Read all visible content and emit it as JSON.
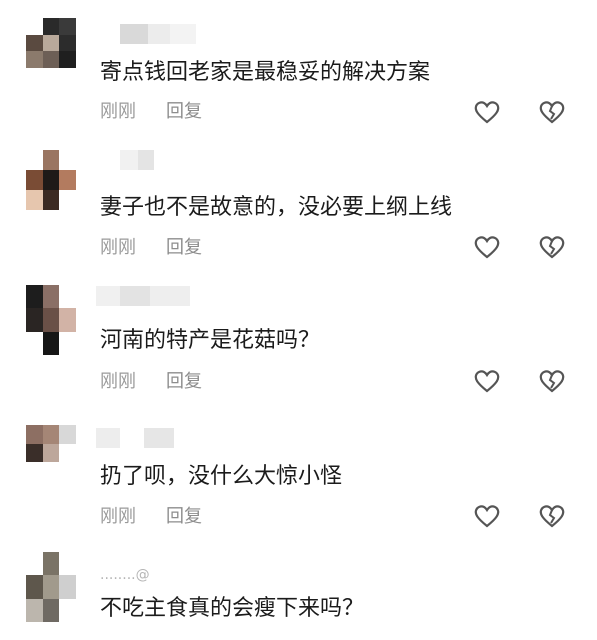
{
  "comments": [
    {
      "text": "寄点钱回老家是最稳妥的解决方案",
      "time": "刚刚",
      "reply": "回复"
    },
    {
      "text": "妻子也不是故意的，没必要上纲上线",
      "time": "刚刚",
      "reply": "回复"
    },
    {
      "text": "河南的特产是花菇吗？",
      "time": "刚刚",
      "reply": "回复"
    },
    {
      "text": "扔了呗，没什么大惊小怪",
      "time": "刚刚",
      "reply": "回复"
    },
    {
      "text": "不吃主食真的会瘦下来吗？",
      "username": "........@"
    }
  ],
  "icons": {
    "like": "heart-outline-icon",
    "dislike": "broken-heart-icon"
  },
  "colors": {
    "text": "#1b1b1b",
    "meta": "#9a9a9a",
    "icon": "#555555"
  }
}
